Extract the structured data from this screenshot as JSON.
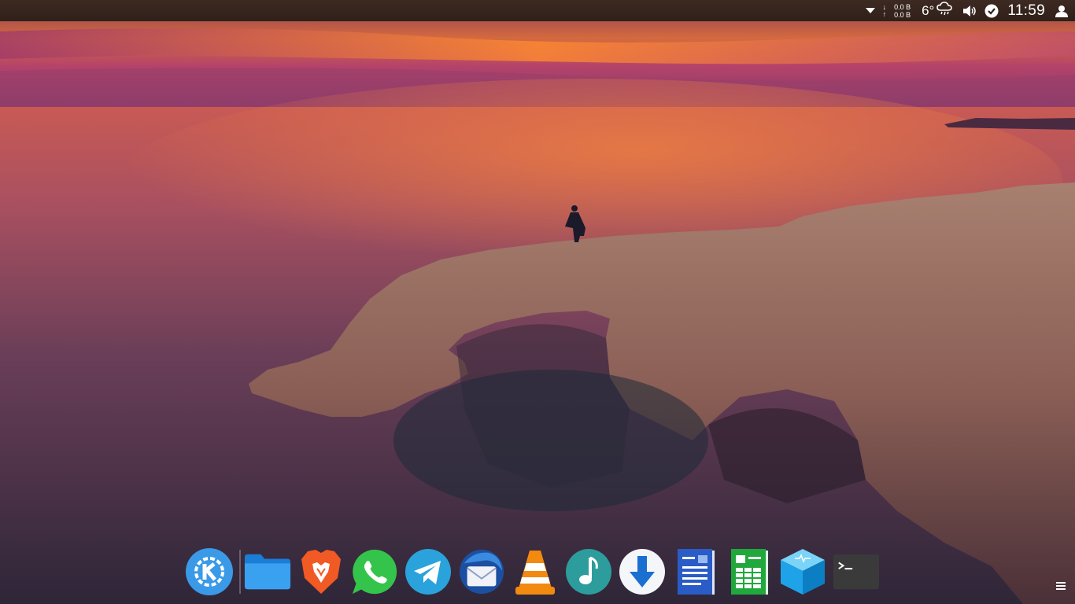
{
  "panel": {
    "netspeed": {
      "download_arrow": "↓",
      "upload_arrow": "↑",
      "download": "0.0 B",
      "upload": "0.0 B"
    },
    "weather": {
      "temperature": "6°",
      "icon": "cloud-rain-icon"
    },
    "volume_icon": "volume-icon",
    "updates_icon": "updates-check-icon",
    "clock": "11:59",
    "user_icon": "user-icon",
    "expander_icon": "tray-expander-icon"
  },
  "dock": {
    "apps": [
      {
        "name": "kde-launcher",
        "icon": "kde-icon",
        "color": "#3a9ae8"
      },
      {
        "name": "files",
        "icon": "folder-icon",
        "color": "#1f8de8"
      },
      {
        "name": "brave",
        "icon": "brave-lion-icon",
        "color": "#f15a24"
      },
      {
        "name": "whatsapp",
        "icon": "whatsapp-icon",
        "color": "#35c44b"
      },
      {
        "name": "telegram",
        "icon": "telegram-icon",
        "color": "#2aa2dc"
      },
      {
        "name": "thunderbird",
        "icon": "thunderbird-icon",
        "color": "#1c4fa0"
      },
      {
        "name": "vlc",
        "icon": "vlc-cone-icon",
        "color": "#f28a10"
      },
      {
        "name": "music",
        "icon": "music-note-icon",
        "color": "#2d9c9c"
      },
      {
        "name": "downloader",
        "icon": "download-arrow-icon",
        "color": "#1a6fd0"
      },
      {
        "name": "writer",
        "icon": "document-icon",
        "color": "#2a5cc7"
      },
      {
        "name": "calc",
        "icon": "spreadsheet-icon",
        "color": "#20a83c"
      },
      {
        "name": "virtual-box",
        "icon": "cube-icon",
        "color": "#1fa3e8"
      },
      {
        "name": "terminal",
        "icon": "terminal-icon",
        "color": "#3a3a3a"
      }
    ],
    "menu_icon": "hamburger-menu-icon"
  }
}
